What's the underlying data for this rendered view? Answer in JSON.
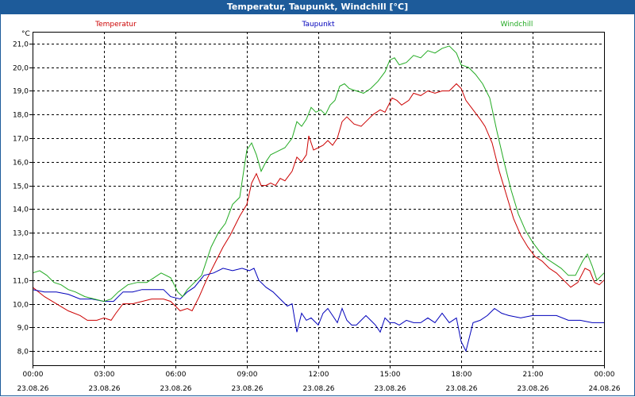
{
  "window": {
    "title": "Temperatur, Taupunkt, Windchill [°C]"
  },
  "colors": {
    "titlebar": "#1d5b9a",
    "temperature": "#cc0000",
    "dewpoint": "#0000bb",
    "windchill": "#22aa22",
    "grid": "#000000"
  },
  "chart_data": {
    "type": "line",
    "title": "Temperatur, Taupunkt, Windchill [°C]",
    "ylabel": "°C",
    "xlabel": "",
    "ylim": [
      7.4,
      21.5
    ],
    "xlim": [
      0,
      24
    ],
    "grid": true,
    "legend_placement": "top",
    "y_ticks": [
      {
        "v": 8.0,
        "label": "8,0"
      },
      {
        "v": 9.0,
        "label": "9,0"
      },
      {
        "v": 10.0,
        "label": "10,0"
      },
      {
        "v": 11.0,
        "label": "11,0"
      },
      {
        "v": 12.0,
        "label": "12,0"
      },
      {
        "v": 13.0,
        "label": "13,0"
      },
      {
        "v": 14.0,
        "label": "14,0"
      },
      {
        "v": 15.0,
        "label": "15,0"
      },
      {
        "v": 16.0,
        "label": "16,0"
      },
      {
        "v": 17.0,
        "label": "17,0"
      },
      {
        "v": 18.0,
        "label": "18,0"
      },
      {
        "v": 19.0,
        "label": "19,0"
      },
      {
        "v": 20.0,
        "label": "20,0"
      },
      {
        "v": 21.0,
        "label": "21,0"
      }
    ],
    "x_ticks": [
      {
        "h": 0,
        "time": "00:00",
        "date": "23.08.26"
      },
      {
        "h": 3,
        "time": "03:00",
        "date": "23.08.26"
      },
      {
        "h": 6,
        "time": "06:00",
        "date": "23.08.26"
      },
      {
        "h": 9,
        "time": "09:00",
        "date": "23.08.26"
      },
      {
        "h": 12,
        "time": "12:00",
        "date": "23.08.26"
      },
      {
        "h": 15,
        "time": "15:00",
        "date": "23.08.26"
      },
      {
        "h": 18,
        "time": "18:00",
        "date": "23.08.26"
      },
      {
        "h": 21,
        "time": "21:00",
        "date": "23.08.26"
      },
      {
        "h": 24,
        "time": "00:00",
        "date": "24.08.26"
      }
    ],
    "series": [
      {
        "name": "Temperatur",
        "color": "#cc0000",
        "points": [
          [
            0,
            10.7
          ],
          [
            0.5,
            10.3
          ],
          [
            1,
            10.0
          ],
          [
            1.5,
            9.7
          ],
          [
            2,
            9.5
          ],
          [
            2.3,
            9.3
          ],
          [
            2.7,
            9.3
          ],
          [
            3.0,
            9.4
          ],
          [
            3.3,
            9.3
          ],
          [
            3.5,
            9.6
          ],
          [
            3.8,
            10.0
          ],
          [
            4.2,
            10.0
          ],
          [
            4.6,
            10.1
          ],
          [
            5.0,
            10.2
          ],
          [
            5.5,
            10.2
          ],
          [
            5.8,
            10.1
          ],
          [
            6.0,
            9.9
          ],
          [
            6.2,
            9.7
          ],
          [
            6.5,
            9.8
          ],
          [
            6.7,
            9.7
          ],
          [
            7.0,
            10.3
          ],
          [
            7.3,
            11.0
          ],
          [
            7.7,
            11.8
          ],
          [
            8.0,
            12.4
          ],
          [
            8.3,
            12.9
          ],
          [
            8.7,
            13.7
          ],
          [
            9.0,
            14.2
          ],
          [
            9.2,
            15.1
          ],
          [
            9.4,
            15.5
          ],
          [
            9.6,
            15.0
          ],
          [
            9.8,
            15.0
          ],
          [
            10.0,
            15.1
          ],
          [
            10.2,
            15.0
          ],
          [
            10.4,
            15.3
          ],
          [
            10.6,
            15.2
          ],
          [
            10.9,
            15.6
          ],
          [
            11.1,
            16.2
          ],
          [
            11.3,
            16.0
          ],
          [
            11.5,
            16.3
          ],
          [
            11.6,
            17.1
          ],
          [
            11.8,
            16.5
          ],
          [
            12.0,
            16.6
          ],
          [
            12.2,
            16.7
          ],
          [
            12.4,
            16.9
          ],
          [
            12.6,
            16.7
          ],
          [
            12.8,
            17.0
          ],
          [
            13.0,
            17.7
          ],
          [
            13.2,
            17.9
          ],
          [
            13.5,
            17.6
          ],
          [
            13.8,
            17.5
          ],
          [
            14.1,
            17.8
          ],
          [
            14.3,
            18.0
          ],
          [
            14.6,
            18.2
          ],
          [
            14.8,
            18.1
          ],
          [
            15.1,
            18.7
          ],
          [
            15.3,
            18.6
          ],
          [
            15.5,
            18.4
          ],
          [
            15.8,
            18.6
          ],
          [
            16.0,
            18.9
          ],
          [
            16.3,
            18.8
          ],
          [
            16.6,
            19.0
          ],
          [
            16.9,
            18.9
          ],
          [
            17.2,
            19.0
          ],
          [
            17.5,
            19.0
          ],
          [
            17.8,
            19.3
          ],
          [
            18.0,
            19.1
          ],
          [
            18.2,
            18.6
          ],
          [
            18.5,
            18.2
          ],
          [
            18.8,
            17.8
          ],
          [
            19.0,
            17.5
          ],
          [
            19.3,
            16.8
          ],
          [
            19.6,
            15.6
          ],
          [
            19.9,
            14.6
          ],
          [
            20.2,
            13.6
          ],
          [
            20.5,
            12.9
          ],
          [
            20.8,
            12.4
          ],
          [
            21.1,
            12.0
          ],
          [
            21.4,
            11.8
          ],
          [
            21.7,
            11.5
          ],
          [
            22.0,
            11.3
          ],
          [
            22.3,
            11.0
          ],
          [
            22.6,
            10.7
          ],
          [
            22.9,
            10.9
          ],
          [
            23.2,
            11.5
          ],
          [
            23.4,
            11.4
          ],
          [
            23.6,
            10.9
          ],
          [
            23.8,
            10.8
          ],
          [
            24,
            11.0
          ]
        ]
      },
      {
        "name": "Taupunkt",
        "color": "#0000bb",
        "points": [
          [
            0,
            10.6
          ],
          [
            0.5,
            10.5
          ],
          [
            1,
            10.5
          ],
          [
            1.5,
            10.4
          ],
          [
            2,
            10.2
          ],
          [
            2.5,
            10.2
          ],
          [
            3.0,
            10.1
          ],
          [
            3.4,
            10.1
          ],
          [
            3.8,
            10.5
          ],
          [
            4.2,
            10.5
          ],
          [
            4.6,
            10.6
          ],
          [
            5.0,
            10.6
          ],
          [
            5.5,
            10.6
          ],
          [
            5.8,
            10.3
          ],
          [
            6.2,
            10.2
          ],
          [
            6.5,
            10.5
          ],
          [
            6.8,
            10.7
          ],
          [
            7.2,
            11.2
          ],
          [
            7.6,
            11.3
          ],
          [
            8.0,
            11.5
          ],
          [
            8.4,
            11.4
          ],
          [
            8.8,
            11.5
          ],
          [
            9.1,
            11.4
          ],
          [
            9.3,
            11.5
          ],
          [
            9.5,
            11.0
          ],
          [
            9.8,
            10.7
          ],
          [
            10.1,
            10.5
          ],
          [
            10.4,
            10.2
          ],
          [
            10.7,
            9.9
          ],
          [
            10.9,
            10.0
          ],
          [
            11.1,
            8.8
          ],
          [
            11.3,
            9.6
          ],
          [
            11.5,
            9.3
          ],
          [
            11.7,
            9.4
          ],
          [
            11.9,
            9.2
          ],
          [
            12.0,
            9.1
          ],
          [
            12.2,
            9.6
          ],
          [
            12.4,
            9.8
          ],
          [
            12.6,
            9.5
          ],
          [
            12.8,
            9.2
          ],
          [
            13.0,
            9.8
          ],
          [
            13.2,
            9.3
          ],
          [
            13.4,
            9.1
          ],
          [
            13.6,
            9.1
          ],
          [
            13.8,
            9.3
          ],
          [
            14.0,
            9.5
          ],
          [
            14.2,
            9.3
          ],
          [
            14.4,
            9.1
          ],
          [
            14.6,
            8.8
          ],
          [
            14.8,
            9.4
          ],
          [
            15.0,
            9.2
          ],
          [
            15.2,
            9.2
          ],
          [
            15.4,
            9.1
          ],
          [
            15.7,
            9.3
          ],
          [
            16.0,
            9.2
          ],
          [
            16.3,
            9.2
          ],
          [
            16.6,
            9.4
          ],
          [
            16.9,
            9.2
          ],
          [
            17.2,
            9.6
          ],
          [
            17.5,
            9.2
          ],
          [
            17.8,
            9.4
          ],
          [
            18.0,
            8.4
          ],
          [
            18.2,
            8.0
          ],
          [
            18.5,
            9.2
          ],
          [
            18.8,
            9.3
          ],
          [
            19.1,
            9.5
          ],
          [
            19.4,
            9.8
          ],
          [
            19.7,
            9.6
          ],
          [
            20.0,
            9.5
          ],
          [
            20.5,
            9.4
          ],
          [
            21.0,
            9.5
          ],
          [
            21.5,
            9.5
          ],
          [
            22.0,
            9.5
          ],
          [
            22.5,
            9.3
          ],
          [
            23.0,
            9.3
          ],
          [
            23.5,
            9.2
          ],
          [
            24,
            9.2
          ]
        ]
      },
      {
        "name": "Windchill",
        "color": "#22aa22",
        "points": [
          [
            0,
            11.3
          ],
          [
            0.3,
            11.4
          ],
          [
            0.6,
            11.2
          ],
          [
            0.9,
            10.9
          ],
          [
            1.2,
            10.8
          ],
          [
            1.5,
            10.6
          ],
          [
            1.8,
            10.5
          ],
          [
            2.2,
            10.3
          ],
          [
            2.6,
            10.2
          ],
          [
            3.0,
            10.1
          ],
          [
            3.3,
            10.2
          ],
          [
            3.6,
            10.5
          ],
          [
            4.0,
            10.8
          ],
          [
            4.4,
            10.9
          ],
          [
            4.8,
            10.9
          ],
          [
            5.1,
            11.1
          ],
          [
            5.4,
            11.3
          ],
          [
            5.8,
            11.1
          ],
          [
            6.1,
            10.5
          ],
          [
            6.3,
            10.3
          ],
          [
            6.5,
            10.6
          ],
          [
            6.8,
            10.9
          ],
          [
            7.1,
            11.2
          ],
          [
            7.5,
            12.4
          ],
          [
            7.8,
            13.0
          ],
          [
            8.1,
            13.4
          ],
          [
            8.4,
            14.2
          ],
          [
            8.7,
            14.5
          ],
          [
            9.0,
            16.5
          ],
          [
            9.2,
            16.8
          ],
          [
            9.4,
            16.3
          ],
          [
            9.6,
            15.6
          ],
          [
            9.8,
            16.0
          ],
          [
            10.0,
            16.3
          ],
          [
            10.2,
            16.4
          ],
          [
            10.4,
            16.5
          ],
          [
            10.6,
            16.6
          ],
          [
            10.9,
            17.0
          ],
          [
            11.1,
            17.7
          ],
          [
            11.3,
            17.5
          ],
          [
            11.5,
            17.8
          ],
          [
            11.7,
            18.3
          ],
          [
            11.9,
            18.1
          ],
          [
            12.1,
            18.2
          ],
          [
            12.3,
            18.0
          ],
          [
            12.5,
            18.4
          ],
          [
            12.7,
            18.6
          ],
          [
            12.9,
            19.2
          ],
          [
            13.1,
            19.3
          ],
          [
            13.3,
            19.1
          ],
          [
            13.6,
            19.0
          ],
          [
            13.9,
            18.9
          ],
          [
            14.2,
            19.1
          ],
          [
            14.5,
            19.4
          ],
          [
            14.8,
            19.8
          ],
          [
            15.0,
            20.3
          ],
          [
            15.2,
            20.4
          ],
          [
            15.4,
            20.1
          ],
          [
            15.7,
            20.2
          ],
          [
            16.0,
            20.5
          ],
          [
            16.3,
            20.4
          ],
          [
            16.6,
            20.7
          ],
          [
            16.9,
            20.6
          ],
          [
            17.2,
            20.8
          ],
          [
            17.5,
            20.9
          ],
          [
            17.8,
            20.6
          ],
          [
            18.0,
            20.1
          ],
          [
            18.3,
            20.0
          ],
          [
            18.6,
            19.7
          ],
          [
            18.9,
            19.3
          ],
          [
            19.2,
            18.7
          ],
          [
            19.5,
            17.3
          ],
          [
            19.8,
            16.0
          ],
          [
            20.1,
            14.8
          ],
          [
            20.4,
            13.8
          ],
          [
            20.7,
            13.1
          ],
          [
            21.0,
            12.6
          ],
          [
            21.3,
            12.2
          ],
          [
            21.6,
            11.9
          ],
          [
            21.9,
            11.7
          ],
          [
            22.2,
            11.5
          ],
          [
            22.5,
            11.2
          ],
          [
            22.8,
            11.2
          ],
          [
            23.1,
            11.8
          ],
          [
            23.3,
            12.1
          ],
          [
            23.5,
            11.6
          ],
          [
            23.7,
            11.0
          ],
          [
            24,
            11.3
          ]
        ]
      }
    ]
  }
}
